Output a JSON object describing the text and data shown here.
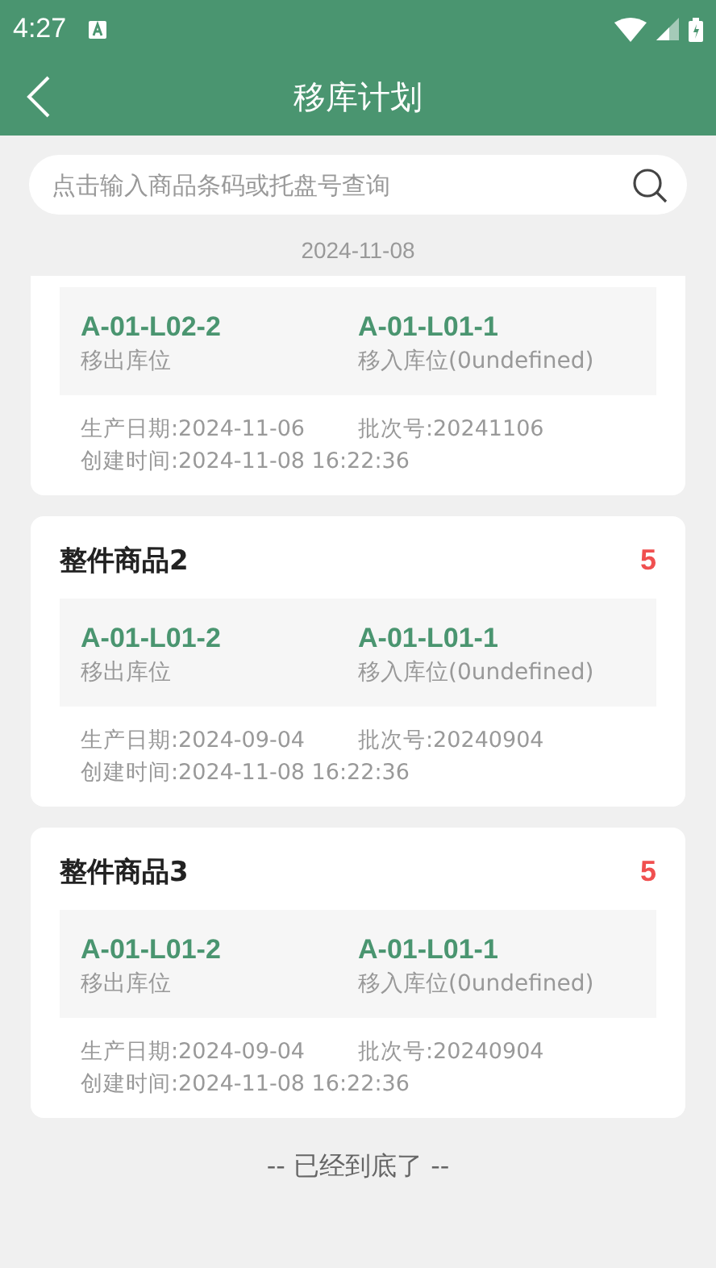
{
  "status_bar": {
    "time": "4:27"
  },
  "header": {
    "title": "移库计划"
  },
  "search": {
    "placeholder": "点击输入商品条码或托盘号查询"
  },
  "date": "2024-11-08",
  "cards": [
    {
      "from": "A-01-L02-2",
      "from_label": "移出库位",
      "to": "A-01-L01-1",
      "to_label": "移入库位(0undefined)",
      "production_date": "生产日期:2024-11-06",
      "batch": "批次号:20241106",
      "created": "创建时间:2024-11-08 16:22:36"
    },
    {
      "name": "整件商品2",
      "count": "5",
      "from": "A-01-L01-2",
      "from_label": "移出库位",
      "to": "A-01-L01-1",
      "to_label": "移入库位(0undefined)",
      "production_date": "生产日期:2024-09-04",
      "batch": "批次号:20240904",
      "created": "创建时间:2024-11-08 16:22:36"
    },
    {
      "name": "整件商品3",
      "count": "5",
      "from": "A-01-L01-2",
      "from_label": "移出库位",
      "to": "A-01-L01-1",
      "to_label": "移入库位(0undefined)",
      "production_date": "生产日期:2024-09-04",
      "batch": "批次号:20240904",
      "created": "创建时间:2024-11-08 16:22:36"
    }
  ],
  "footer": "-- 已经到底了 --"
}
